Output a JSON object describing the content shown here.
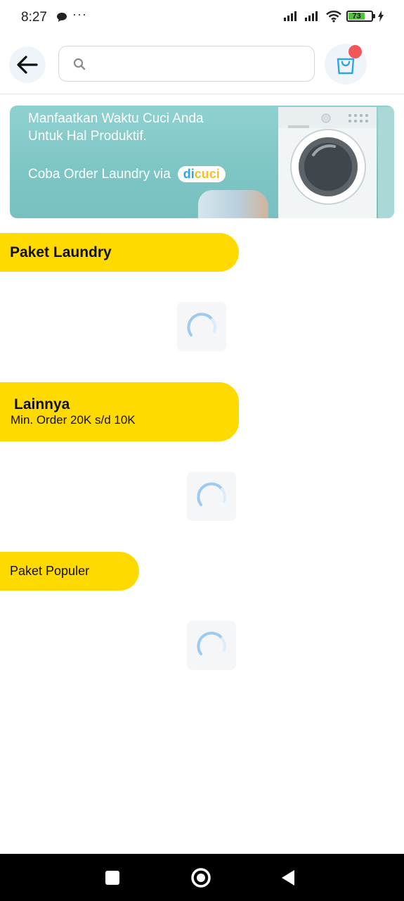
{
  "status_bar": {
    "time": "8:27",
    "more": "···",
    "battery_level": "73",
    "icons": [
      "chat-bubble-icon",
      "signal-icon",
      "signal-icon",
      "wifi-icon",
      "battery-icon",
      "charging-icon"
    ]
  },
  "header": {
    "back_icon": "arrow-left-icon",
    "search": {
      "value": "",
      "placeholder": "",
      "icon": "search-icon"
    },
    "cart_icon": "shopping-bag-icon",
    "cart_badge_color": "#f25757"
  },
  "banner": {
    "line1": "Manfaatkan Waktu Cuci Anda",
    "line2": "Untuk Hal Produktif.",
    "line3": "Coba Order Laundry via",
    "brand_part1": "di",
    "brand_part2": "cuci",
    "image": "washing-machine"
  },
  "sections": [
    {
      "title": "Paket Laundry"
    },
    {
      "title": "Lainnya",
      "subtitle": "Min. Order 20K s/d 10K"
    },
    {
      "title": "Paket Populer"
    }
  ],
  "colors": {
    "accent": "#ffda00",
    "banner": "#85cbca",
    "spinner": "#9ccaf0",
    "icon_blue": "#2fa5e2"
  },
  "nav_bar": {
    "icons": [
      "square-icon",
      "circle-home-icon",
      "triangle-back-icon"
    ]
  }
}
